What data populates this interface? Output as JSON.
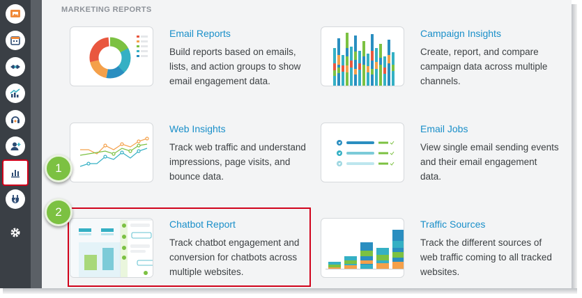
{
  "section": {
    "title": "MARKETING REPORTS"
  },
  "cards": [
    {
      "title": "Email Reports",
      "desc": "Build reports based on emails, lists, and action groups to show email engagement data."
    },
    {
      "title": "Campaign Insights",
      "desc": "Create, report, and compare campaign data across multiple channels."
    },
    {
      "title": "Web Insights",
      "desc": "Track web traffic and understand impressions, page visits, and bounce data."
    },
    {
      "title": "Email Jobs",
      "desc": "View single email sending events and their email engagement data."
    },
    {
      "title": "Chatbot Report",
      "desc": "Track chatbot engagement and conversion for chatbots across multiple websites."
    },
    {
      "title": "Traffic Sources",
      "desc": "Track the different sources of web traffic coming to all tracked websites."
    }
  ],
  "callouts": [
    "1",
    "2"
  ],
  "sidebar": {
    "icons": [
      "media-icon",
      "calendar-icon",
      "handshake-icon",
      "analytics-icon",
      "support-icon",
      "add-contact-icon",
      "reports-icon",
      "plugin-icon",
      "gear-icon"
    ]
  },
  "colors": {
    "accent": "#1a8fc9",
    "highlight": "#d0021b",
    "badge": "#7cc142",
    "sidebar": "#3a3f45"
  }
}
